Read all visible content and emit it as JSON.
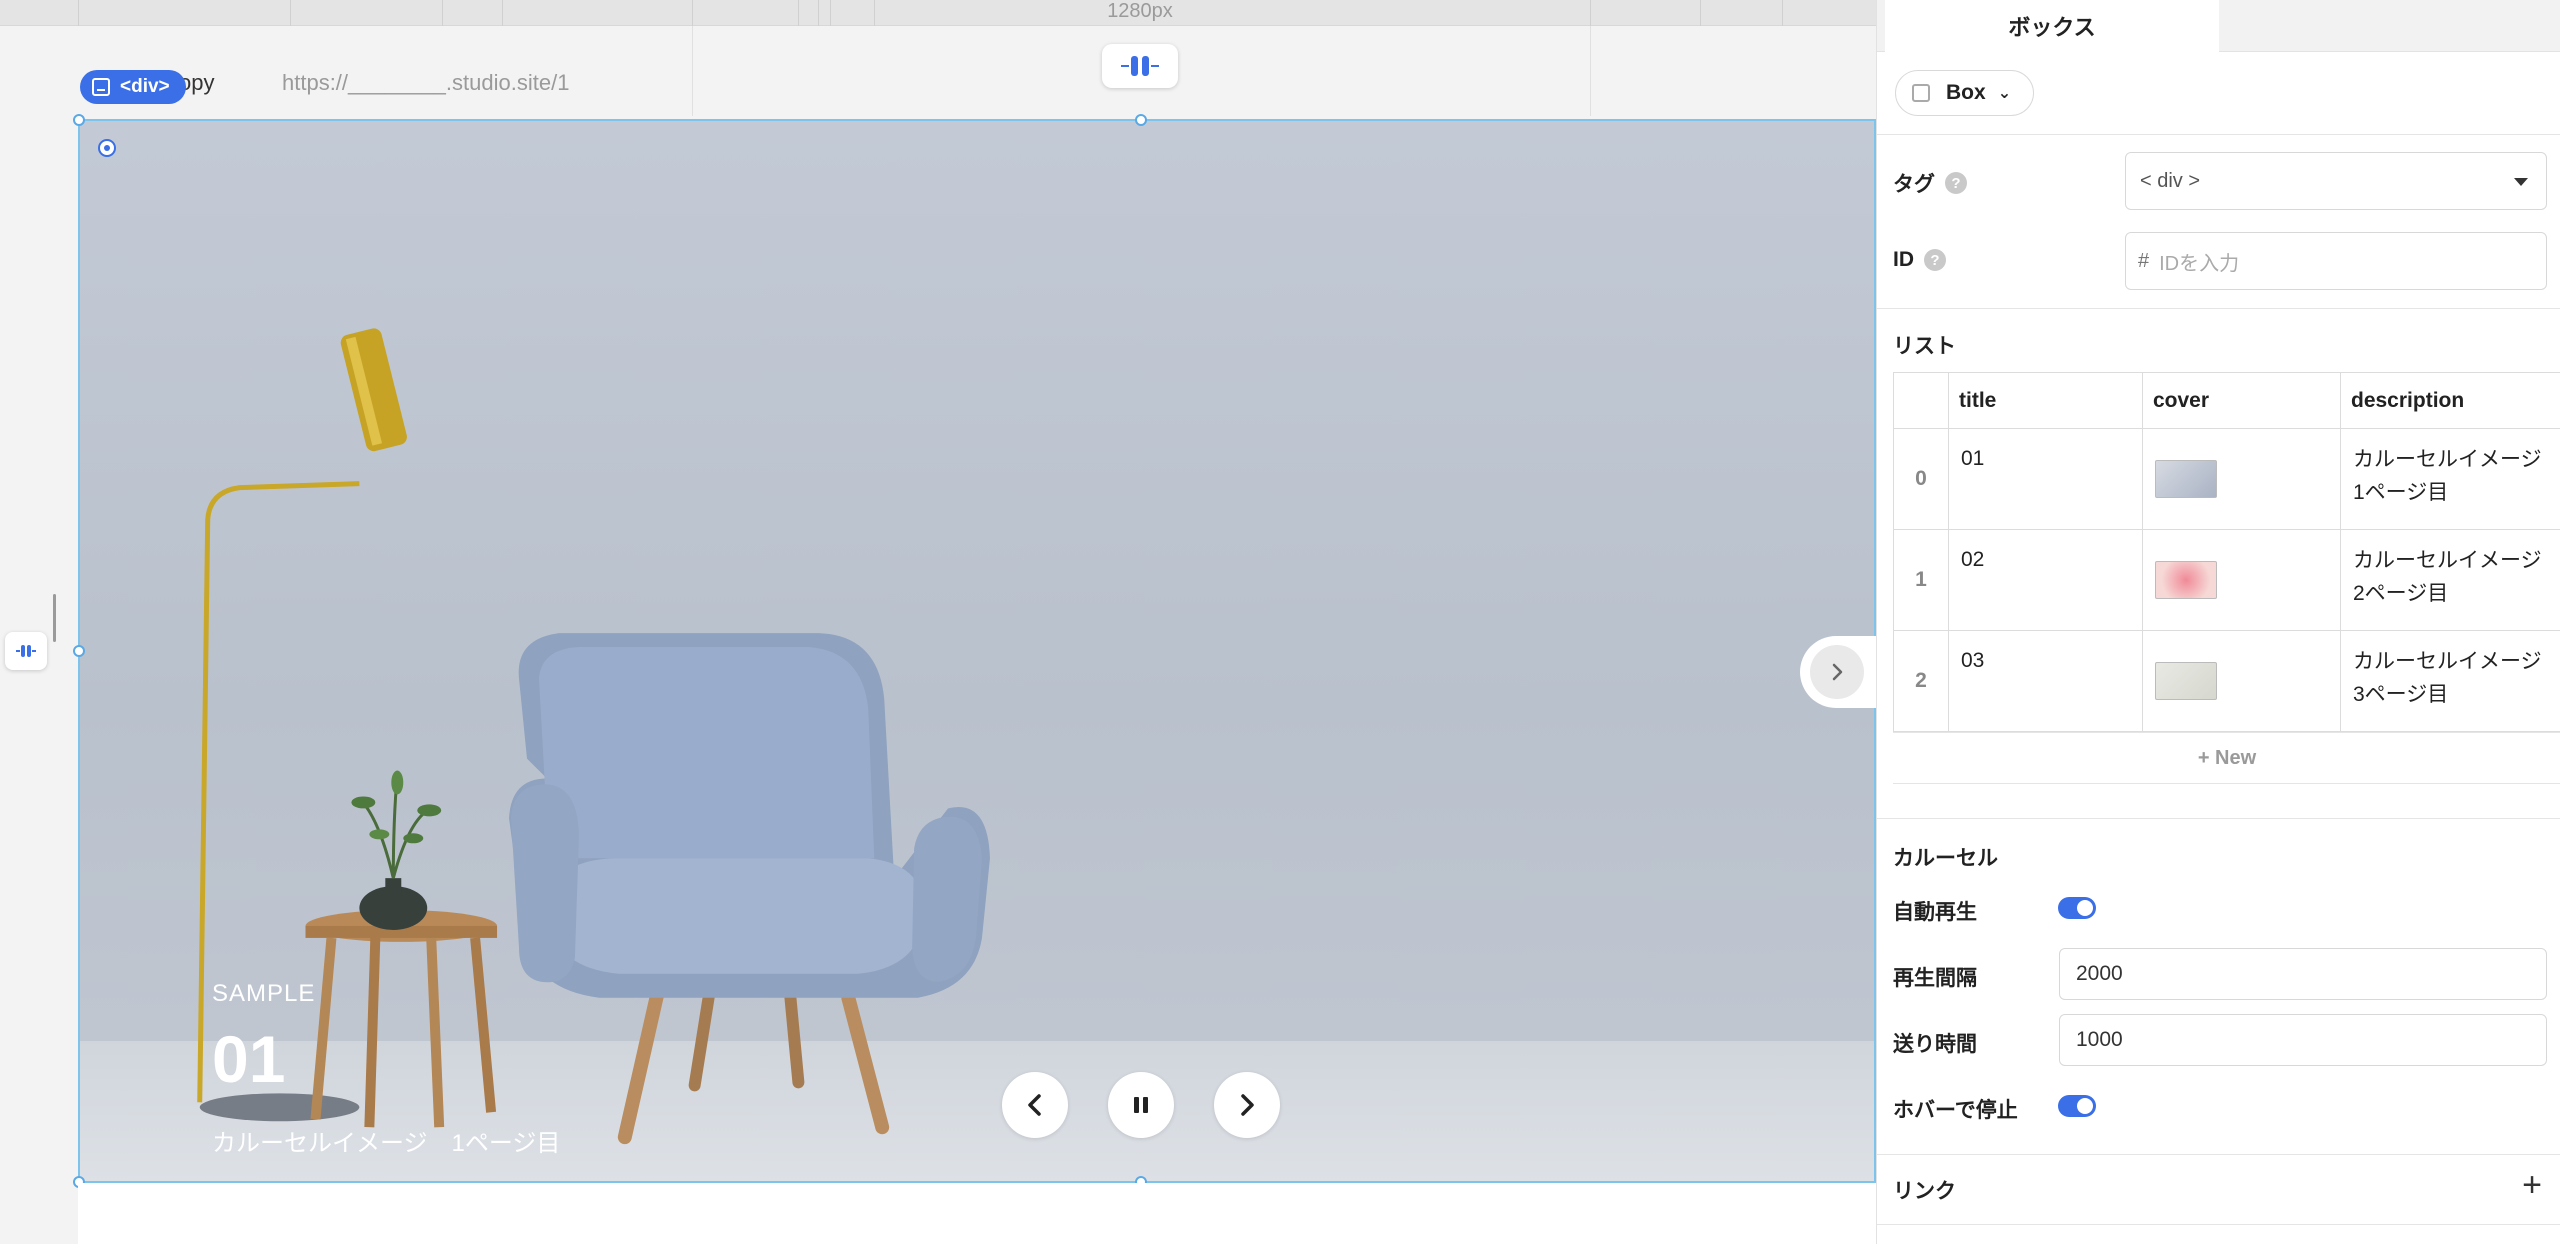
{
  "canvas": {
    "ruler_label": "1280px",
    "page_name": "copy",
    "page_url": "https://________.studio.site/1",
    "selected_tag_badge": "<div>"
  },
  "hero": {
    "kicker": "SAMPLE",
    "title": "01",
    "description": "カルーセルイメージ　1ページ目",
    "prev_icon": "chevron-left-icon",
    "pause_icon": "pause-icon",
    "next_icon": "chevron-right-icon"
  },
  "panel": {
    "tab_label": "ボックス",
    "type_label": "Box",
    "tag": {
      "label": "タグ",
      "value": "< div >"
    },
    "id": {
      "label": "ID",
      "prefix": "#",
      "placeholder": "IDを入力"
    },
    "list": {
      "title": "リスト",
      "columns": [
        "title",
        "cover",
        "description"
      ],
      "rows": [
        {
          "index": "0",
          "title": "01",
          "description": "カルーセルイメージ　1ページ目",
          "cover_color": "#c8ccd6"
        },
        {
          "index": "1",
          "title": "02",
          "description": "カルーセルイメージ　2ページ目",
          "cover_color": "#f2c9cc"
        },
        {
          "index": "2",
          "title": "03",
          "description": "カルーセルイメージ　3ページ目",
          "cover_color": "#e3e4dd"
        }
      ],
      "new_label": "+ New"
    },
    "carousel": {
      "title": "カルーセル",
      "autoplay": {
        "label": "自動再生",
        "on": true
      },
      "interval": {
        "label": "再生間隔",
        "value": "2000"
      },
      "transition": {
        "label": "送り時間",
        "value": "1000"
      },
      "pause_on_hover": {
        "label": "ホバーで停止",
        "on": true
      }
    },
    "link": {
      "label": "リンク"
    }
  },
  "colors": {
    "accent": "#3a6fe8",
    "selection": "#7cc4ec"
  }
}
